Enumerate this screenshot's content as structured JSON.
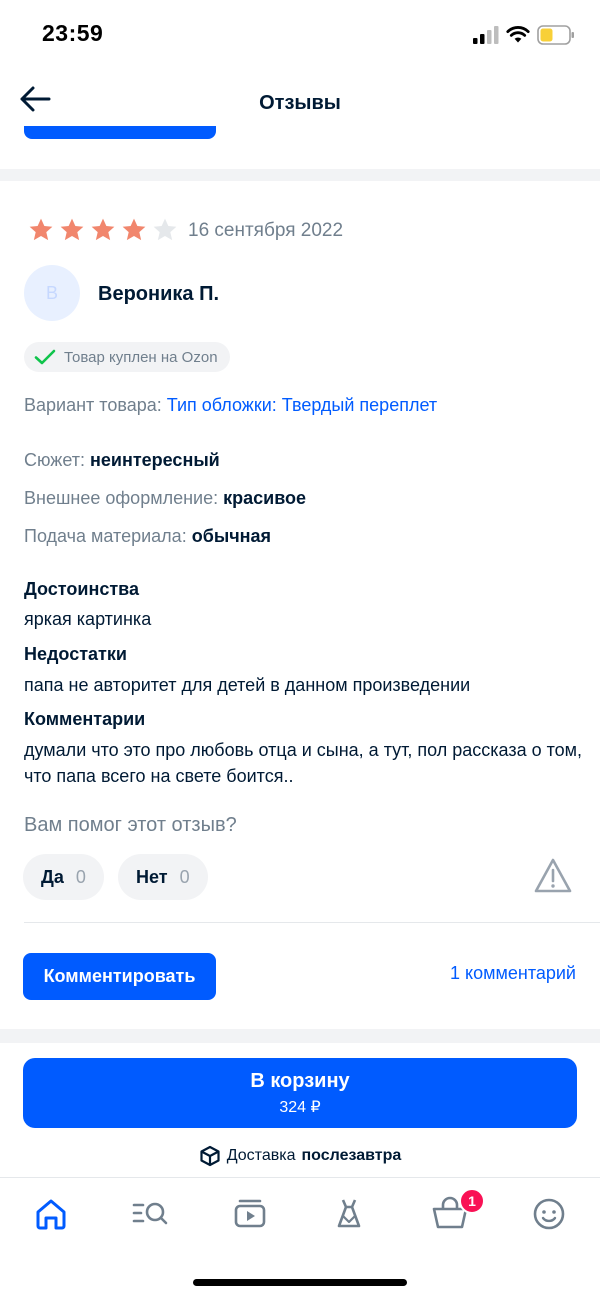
{
  "status_bar": {
    "time": "23:59"
  },
  "header": {
    "title": "Отзывы"
  },
  "review": {
    "rating": 4,
    "max_rating": 5,
    "date": "16 сентября 2022",
    "avatar_letter": "В",
    "author": "Вероника П.",
    "bought_badge": "Товар куплен на Ozon",
    "variant_label": "Вариант товара:",
    "variant_value": "Тип обложки: Твердый переплет",
    "attributes": [
      {
        "label": "Сюжет:",
        "value": "неинтересный"
      },
      {
        "label": "Внешнее оформление:",
        "value": "красивое"
      },
      {
        "label": "Подача материала:",
        "value": "обычная"
      }
    ],
    "pros_title": "Достоинства",
    "pros_text": "яркая картинка",
    "cons_title": "Недостатки",
    "cons_text": "папа не авторитет для детей в данном произведении",
    "comment_title": "Комментарии",
    "comment_text": "думали что это про любовь отца и сына, а тут, пол рассказа о том, что папа всего на свете боится..",
    "helpful_question": "Вам помог этот отзыв?",
    "yes_label": "Да",
    "yes_count": "0",
    "no_label": "Нет",
    "no_count": "0",
    "comment_button": "Комментировать",
    "comments_link": "1 комментарий"
  },
  "purchase": {
    "cart_label": "В корзину",
    "price": "324 ₽",
    "delivery_prefix": "Доставка",
    "delivery_when": "послезавтра"
  },
  "tabbar": {
    "items": [
      "home-icon",
      "catalog-search-icon",
      "video-icon",
      "fresh-dress-icon",
      "cart-icon",
      "profile-icon"
    ],
    "cart_badge": "1"
  },
  "colors": {
    "accent": "#005bff",
    "star": "#f1866d",
    "star_empty": "#e5e8eb",
    "badge": "#f91155",
    "check": "#10c44c"
  }
}
